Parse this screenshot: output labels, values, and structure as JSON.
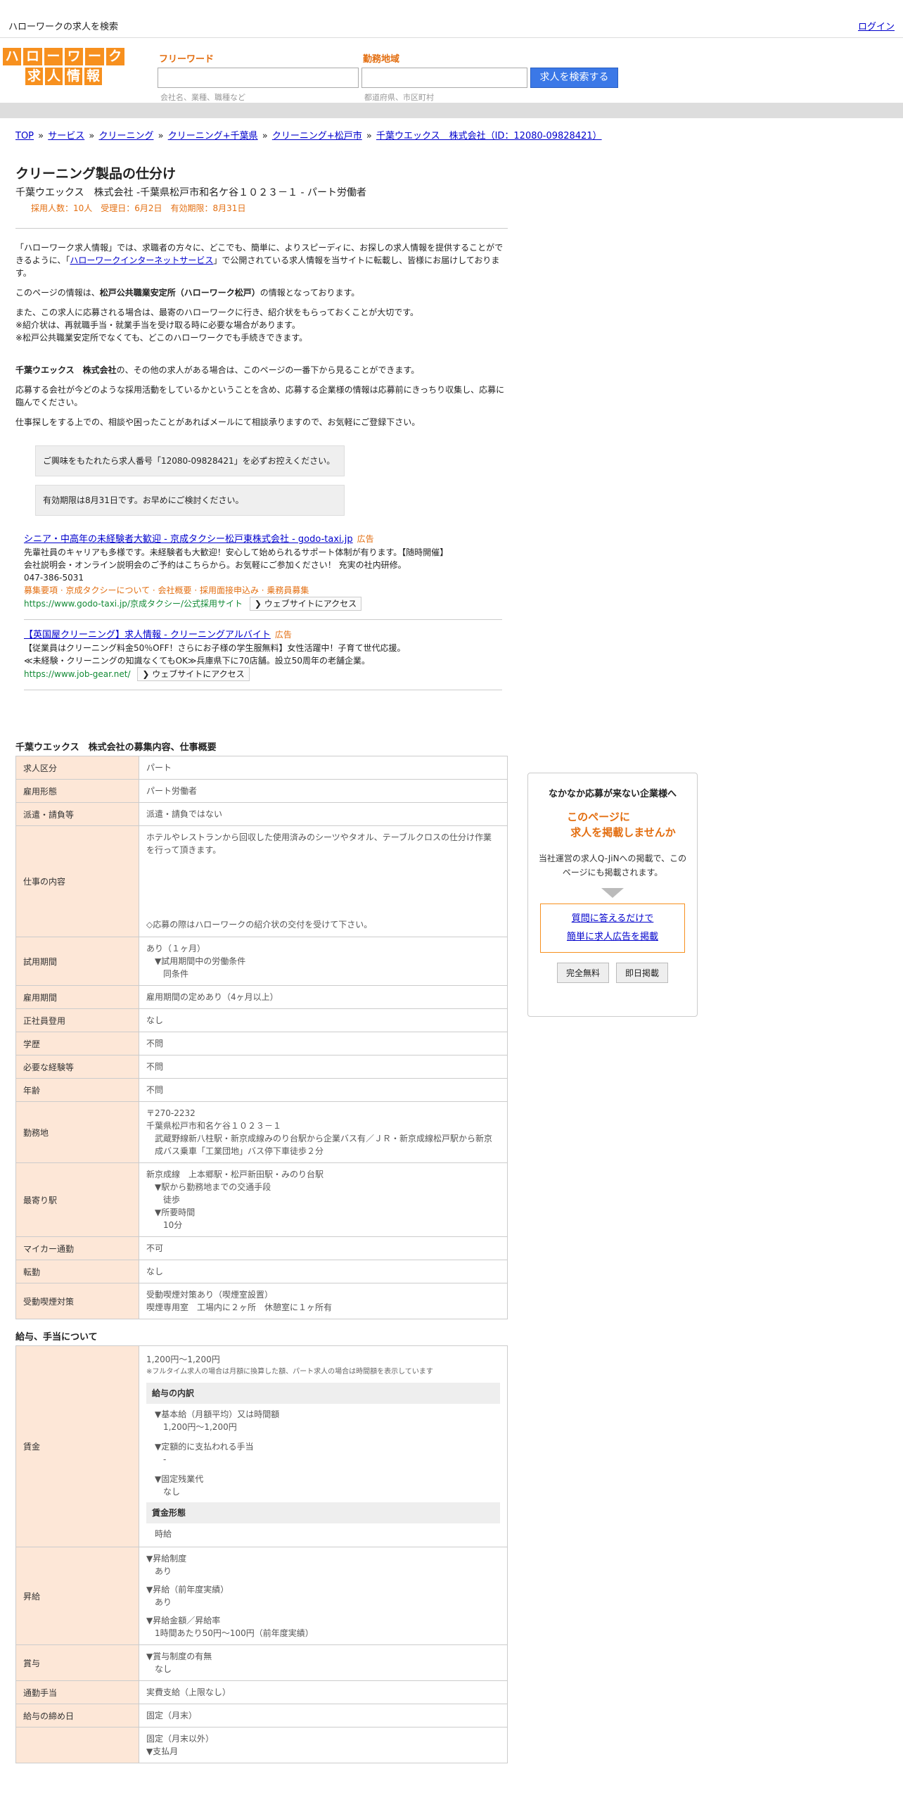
{
  "topbar": {
    "title": "ハローワークの求人を検索",
    "login": "ログイン"
  },
  "logo": {
    "row1": [
      "ハ",
      "ロ",
      "ー",
      "ワ",
      "ー",
      "ク"
    ],
    "row2": [
      "求",
      "人",
      "情",
      "報"
    ]
  },
  "search": {
    "freeword_label": "フリーワード",
    "freeword_hint": "会社名、業種、職種など",
    "area_label": "勤務地域",
    "area_hint": "都道府県、市区町村",
    "button": "求人を検索する"
  },
  "breadcrumb": [
    "TOP",
    "サービス",
    "クリーニング",
    "クリーニング+千葉県",
    "クリーニング+松戸市",
    "千葉ウエックス　株式会社（ID：12080-09828421）"
  ],
  "job": {
    "title": "クリーニング製品の仕分け",
    "subtitle": "千葉ウエックス　株式会社 -千葉県松戸市和名ケ谷１０２３－１ - パート労働者",
    "meta": "採用人数：10人　受理日：6月2日　有効期限：8月31日"
  },
  "intro": {
    "p1a": "「ハローワーク求人情報」では、求職者の方々に、どこでも、簡単に、よりスピーディに、お探しの求人情報を提供することができるように、「",
    "p1link": "ハローワークインターネットサービス",
    "p1b": "」で公開されている求人情報を当サイトに転載し、皆様にお届けしております。",
    "p2a": "このページの情報は、",
    "p2b": "松戸公共職業安定所（ハローワーク松戸）",
    "p2c": "の情報となっております。",
    "p3": "また、この求人に応募される場合は、最寄のハローワークに行き、紹介状をもらっておくことが大切です。",
    "p4": "※紹介状は、再就職手当・就業手当を受け取る時に必要な場合があります。",
    "p5": "※松戸公共職業安定所でなくても、どこのハローワークでも手続きできます。",
    "p6a": "千葉ウエックス　株式会社",
    "p6b": "の、その他の求人がある場合は、このページの一番下から見ることができます。",
    "p7": "応募する会社が今どのような採用活動をしているかということを含め、応募する企業様の情報は応募前にきっちり収集し、応募に臨んでください。",
    "p8": "仕事探しをする上での、相談や困ったことがあればメールにて相談承りますので、お気軽にご登録下さい。"
  },
  "notices": [
    "ご興味をもたれたら求人番号「12080-09828421」を必ずお控えください。",
    "有効期限は8月31日です。お早めにご検討ください。"
  ],
  "ads": [
    {
      "title": "シニア・中高年の未経験者大歓迎 - 京成タクシー松戸東株式会社 - godo-taxi.jp",
      "tag": "広告",
      "body": "先輩社員のキャリアも多様です。未経験者も大歓迎！安心して始められるサポート体制が有ります。【随時開催】会社説明会・オンライン説明会のご予約はこちらから。お気軽にご参加ください！ 充実の社内研修。",
      "phone": "047-386-5031",
      "links": "募集要項 · 京成タクシーについて · 会社概要 · 採用面接申込み · 乗務員募集",
      "url": "https://www.godo-taxi.jp/京成タクシー/公式採用サイト",
      "visit": "ウェブサイトにアクセス"
    },
    {
      "title": "【英国屋クリーニング】求人情報 - クリーニングアルバイト",
      "tag": "広告",
      "body1": "【従業員はクリーニング料金50％OFF！さらにお子様の学生服無料】女性活躍中！子育て世代応援。",
      "body2": "≪未経験・クリーニングの知識なくてもOK≫兵庫県下に70店舗。設立50周年の老舗企業。",
      "url": "https://www.job-gear.net/",
      "visit": "ウェブサイトにアクセス"
    }
  ],
  "detail": {
    "title": "千葉ウエックス　株式会社の募集内容、仕事概要",
    "rows": [
      {
        "k": "求人区分",
        "v": [
          "パート"
        ]
      },
      {
        "k": "雇用形態",
        "v": [
          "パート労働者"
        ]
      },
      {
        "k": "派遣・請負等",
        "v": [
          "派遣・請負ではない"
        ]
      },
      {
        "k": "仕事の内容",
        "v": [
          "ホテルやレストランから回収した使用済みのシーツやタオル、テーブルクロスの仕分け作業を行って頂きます。"
        ],
        "tall": true,
        "note": "◇応募の際はハローワークの紹介状の交付を受けて下さい。"
      },
      {
        "k": "試用期間",
        "v": [
          "あり（１ヶ月）"
        ],
        "sub": [
          "▼試用期間中の労働条件",
          "　同条件"
        ]
      },
      {
        "k": "雇用期間",
        "v": [
          "雇用期間の定めあり（4ヶ月以上）"
        ]
      },
      {
        "k": "正社員登用",
        "v": [
          "なし"
        ]
      },
      {
        "k": "学歴",
        "v": [
          "不問"
        ]
      },
      {
        "k": "必要な経験等",
        "v": [
          "不問"
        ]
      },
      {
        "k": "年齢",
        "v": [
          "不問"
        ]
      },
      {
        "k": "勤務地",
        "v": [
          "〒270-2232",
          "千葉県松戸市和名ケ谷１０２３－１"
        ],
        "sub": [
          "武蔵野線新八柱駅・新京成線みのり台駅から企業バス有／ＪＲ・新京成線松戸駅から新京成バス乗車「工業団地」バス停下車徒歩２分"
        ]
      },
      {
        "k": "最寄り駅",
        "v": [
          "新京成線　上本郷駅・松戸新田駅・みのり台駅"
        ],
        "sub": [
          "▼駅から勤務地までの交通手段",
          "　徒歩",
          "▼所要時間",
          "　10分"
        ]
      },
      {
        "k": "マイカー通勤",
        "v": [
          "不可"
        ]
      },
      {
        "k": "転勤",
        "v": [
          "なし"
        ]
      },
      {
        "k": "受動喫煙対策",
        "v": [
          "受動喫煙対策あり（喫煙室設置）",
          "喫煙専用室　工場内に２ヶ所　休憩室に１ヶ所有"
        ]
      }
    ]
  },
  "salary": {
    "title": "給与、手当について",
    "wage_k": "賃金",
    "wage_v": "1,200円〜1,200円",
    "wage_note": "※フルタイム求人の場合は月額に換算した額、パート求人の場合は時間額を表示しています",
    "breakdown_label": "給与の内訳",
    "base_label": "▼基本給（月額平均）又は時間額",
    "base_v": "1,200円〜1,200円",
    "fixed_label": "▼定額的に支払われる手当",
    "fixed_v": "-",
    "overtime_label": "▼固定残業代",
    "overtime_v": "なし",
    "form_label": "賃金形態",
    "form_v": "時給",
    "raise_k": "昇給",
    "raise1_l": "▼昇給制度",
    "raise1_v": "あり",
    "raise2_l": "▼昇給（前年度実績）",
    "raise2_v": "あり",
    "raise3_l": "▼昇給金額／昇給率",
    "raise3_v": "1時間あたり50円〜100円（前年度実績）",
    "bonus_k": "賞与",
    "bonus_l": "▼賞与制度の有無",
    "bonus_v": "なし",
    "commute_k": "通勤手当",
    "commute_v": "実費支給（上限なし）",
    "close_k": "給与の締め日",
    "close_v": "固定（月末）",
    "pay_v1": "固定（月末以外）",
    "pay_v2": "▼支払月"
  },
  "side": {
    "heading": "なかなか応募が来ない企業様へ",
    "catch1": "このページに",
    "catch2": "求人を掲載しませんか",
    "desc": "当社運営の求人Q-JiNへの掲載で、このページにも掲載されます。",
    "link1": "質問に答えるだけで",
    "link2": "簡単に求人広告を掲載",
    "btn1": "完全無料",
    "btn2": "即日掲載"
  }
}
